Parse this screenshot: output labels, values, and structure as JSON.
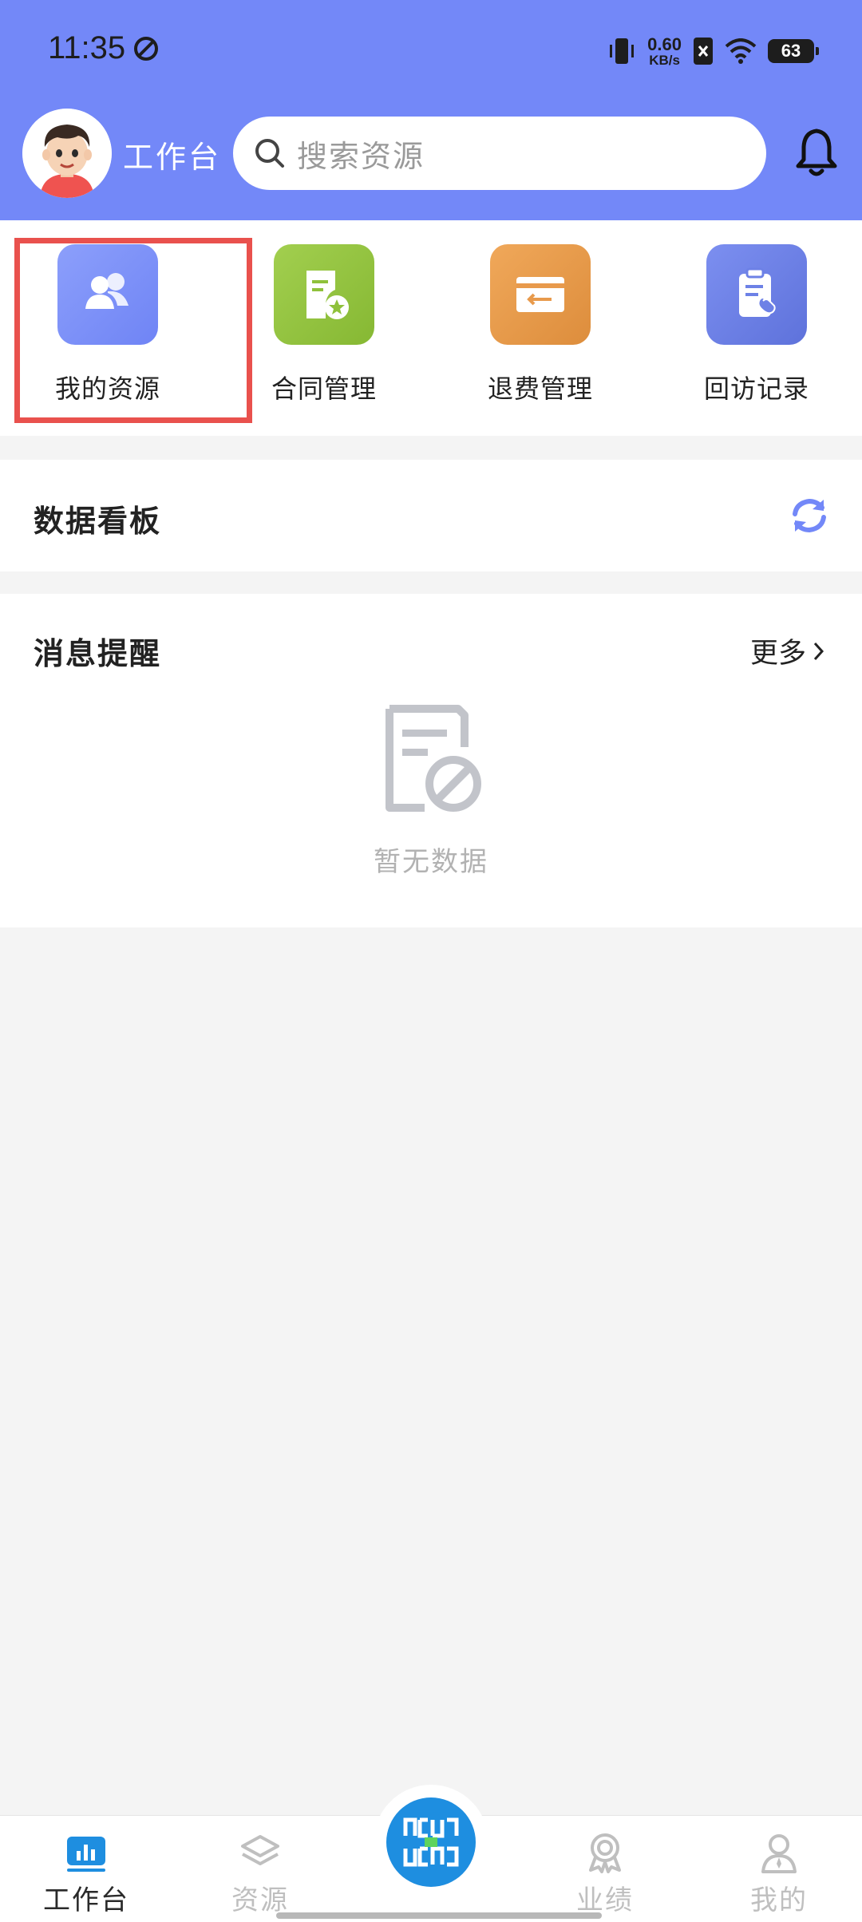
{
  "status_bar": {
    "time": "11:35",
    "net_speed_value": "0.60",
    "net_speed_unit": "KB/s",
    "battery": "63"
  },
  "header": {
    "title": "工作台",
    "search_placeholder": "搜索资源",
    "background_color": "#7388f8"
  },
  "quick_actions": [
    {
      "label": "我的资源",
      "icon": "people-icon",
      "color": "#7b8ef9"
    },
    {
      "label": "合同管理",
      "icon": "contract-icon",
      "color": "#8fc13c"
    },
    {
      "label": "退费管理",
      "icon": "refund-icon",
      "color": "#e89a4c"
    },
    {
      "label": "回访记录",
      "icon": "clipboard-phone-icon",
      "color": "#6d81e6"
    }
  ],
  "dashboard": {
    "title": "数据看板"
  },
  "messages": {
    "title": "消息提醒",
    "more_label": "更多",
    "empty_text": "暂无数据"
  },
  "bottom_nav": {
    "items": [
      {
        "label": "工作台",
        "icon": "dashboard-icon",
        "active": true
      },
      {
        "label": "资源",
        "icon": "layers-icon",
        "active": false
      },
      {
        "label": "业绩",
        "icon": "award-icon",
        "active": false
      },
      {
        "label": "我的",
        "icon": "user-icon",
        "active": false
      }
    ],
    "accent_color": "#1e8ee0"
  }
}
